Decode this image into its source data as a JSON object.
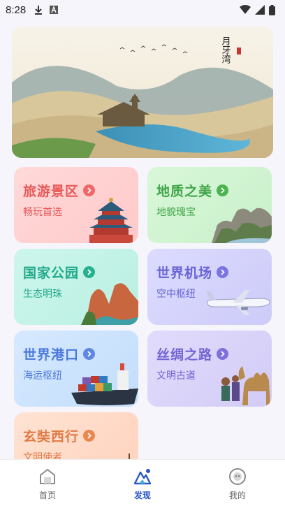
{
  "status_bar": {
    "time": "8:28",
    "left_icons": [
      "download-icon",
      "font-icon"
    ],
    "right_icons": [
      "wifi-icon",
      "signal-icon",
      "battery-icon"
    ]
  },
  "banner": {
    "calligraphy": "月牙湾",
    "scene": "desert-lake-landscape"
  },
  "cards": [
    {
      "title": "旅游景区",
      "subtitle": "畅玩首选",
      "color": "#e85858",
      "icon": "temple-icon"
    },
    {
      "title": "地质之美",
      "subtitle": "地貌瑰宝",
      "color": "#3fa548",
      "icon": "rock-formation-icon"
    },
    {
      "title": "国家公园",
      "subtitle": "生态明珠",
      "color": "#22a98a",
      "icon": "canyon-icon"
    },
    {
      "title": "世界机场",
      "subtitle": "空中枢纽",
      "color": "#6a64d8",
      "icon": "airplane-icon"
    },
    {
      "title": "世界港口",
      "subtitle": "海运枢纽",
      "color": "#4b79dc",
      "icon": "cargo-ship-icon"
    },
    {
      "title": "丝绸之路",
      "subtitle": "文明古道",
      "color": "#7364d4",
      "icon": "camel-caravan-icon"
    },
    {
      "title": "玄奘西行",
      "subtitle": "文明使者",
      "color": "#e07a45",
      "icon": "monk-icon"
    }
  ],
  "bottom_nav": [
    {
      "label": "首页",
      "icon": "home-icon",
      "active": false
    },
    {
      "label": "发现",
      "icon": "discover-icon",
      "active": true
    },
    {
      "label": "我的",
      "icon": "profile-icon",
      "active": false
    }
  ],
  "accent_color": "#2a56c6"
}
